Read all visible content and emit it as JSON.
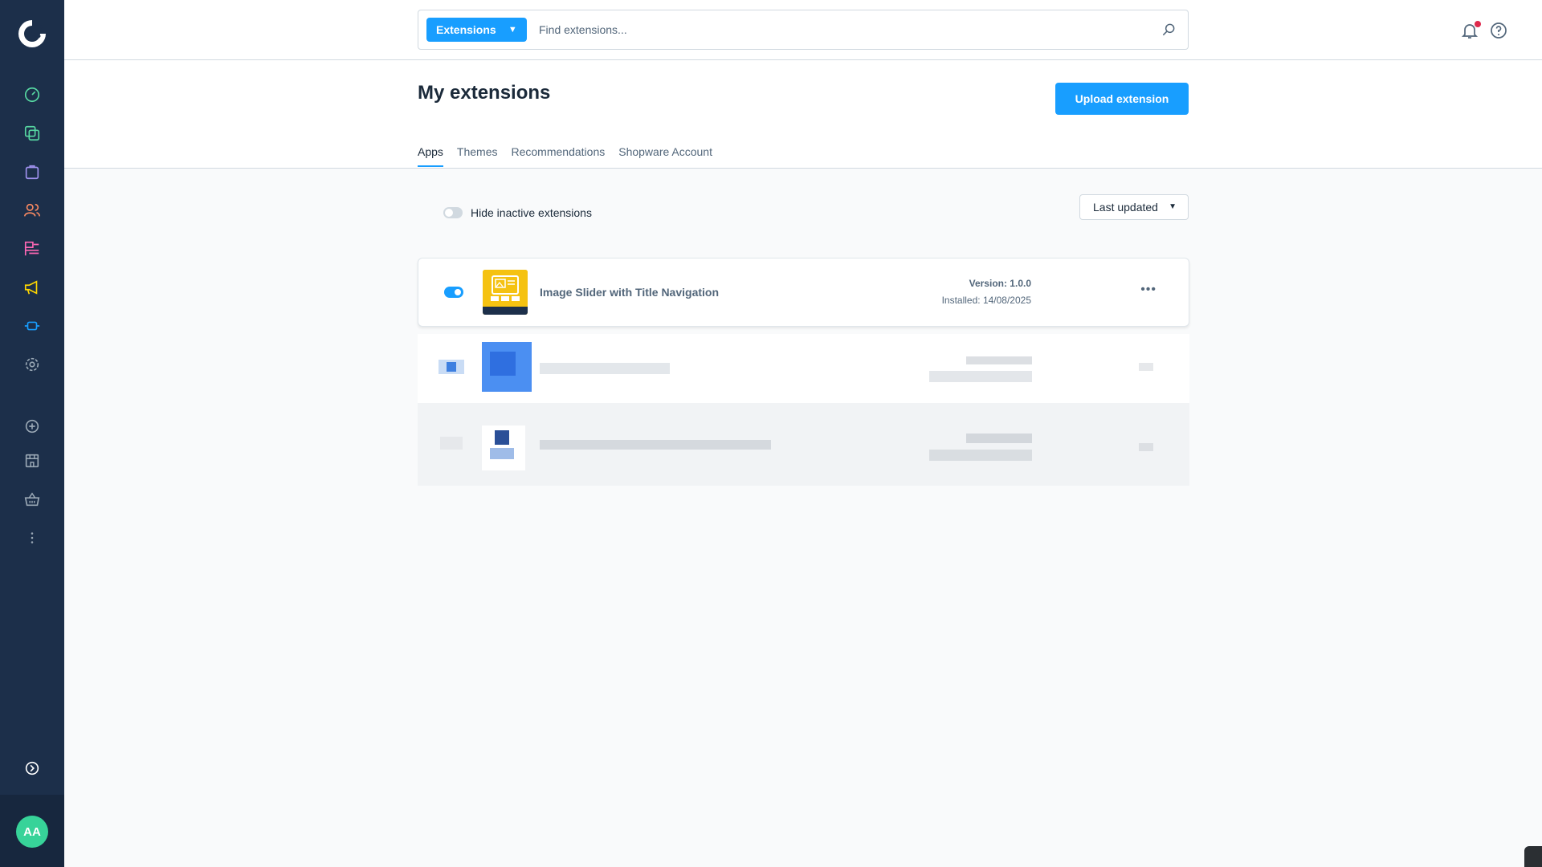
{
  "sidebar": {
    "logo": "shopware-logo",
    "items": [
      {
        "name": "dashboard-icon",
        "color": "#57d9a3"
      },
      {
        "name": "catalogues-icon",
        "color": "#57d9a3"
      },
      {
        "name": "orders-icon",
        "color": "#a092f0"
      },
      {
        "name": "customers-icon",
        "color": "#f88962"
      },
      {
        "name": "content-icon",
        "color": "#ff68b4"
      },
      {
        "name": "marketing-icon",
        "color": "#ffd700"
      },
      {
        "name": "extensions-icon",
        "color": "#189eff"
      },
      {
        "name": "settings-icon",
        "color": "#9aa8b5"
      },
      {
        "name": "add-circle-icon",
        "color": "#9aa8b5"
      },
      {
        "name": "storefront-icon",
        "color": "#9aa8b5"
      },
      {
        "name": "basket-icon",
        "color": "#9aa8b5"
      },
      {
        "name": "more-vertical-icon",
        "color": "#9aa8b5"
      }
    ],
    "collapse_icon": "chevron-circle-right-icon",
    "avatar_initials": "AA"
  },
  "search": {
    "type_label": "Extensions",
    "placeholder": "Find extensions..."
  },
  "header": {
    "title": "My extensions",
    "upload_label": "Upload extension",
    "tabs": [
      {
        "label": "Apps",
        "active": true
      },
      {
        "label": "Themes",
        "active": false
      },
      {
        "label": "Recommendations",
        "active": false
      },
      {
        "label": "Shopware Account",
        "active": false
      }
    ]
  },
  "filters": {
    "hide_inactive_label": "Hide inactive extensions",
    "sort_label": "Last updated"
  },
  "extensions": [
    {
      "name": "Image Slider with Title Navigation",
      "version": "Version: 1.0.0",
      "installed": "Installed: 14/08/2025",
      "active": true
    }
  ],
  "colors": {
    "accent": "#189eff",
    "sidebar": "#1c2f4a",
    "avatar": "#37d399",
    "notification": "#de294c",
    "extension_logo": "#f5c211"
  }
}
